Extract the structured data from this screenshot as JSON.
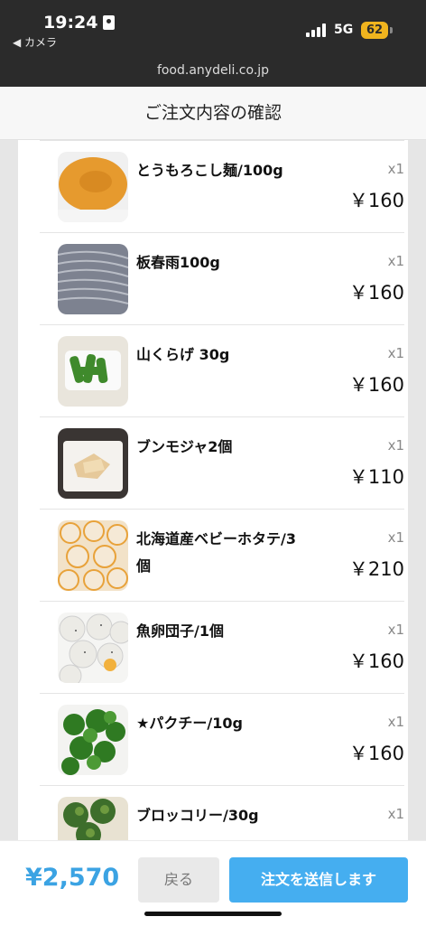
{
  "status_bar": {
    "time": "19:24",
    "back_app": "◀ カメラ",
    "network": "5G",
    "battery": "62",
    "url": "food.anydeli.co.jp"
  },
  "header": {
    "title": "ご注文内容の確認"
  },
  "items": [
    {
      "name": "とうもろこし麺/100g",
      "qty": "x1",
      "price": "￥160",
      "image": "corn-noodle-thumbnail"
    },
    {
      "name": "板春雨100g",
      "qty": "x1",
      "price": "￥160",
      "image": "glass-noodle-thumbnail"
    },
    {
      "name": "山くらげ 30g",
      "qty": "x1",
      "price": "￥160",
      "image": "celtuce-thumbnail"
    },
    {
      "name": "ブンモジャ2個",
      "qty": "x1",
      "price": "￥110",
      "image": "tofu-sheet-thumbnail"
    },
    {
      "name": "北海道産ベビーホタテ/3個",
      "qty": "x1",
      "price": "￥210",
      "image": "baby-scallop-thumbnail"
    },
    {
      "name": "魚卵団子/1個",
      "qty": "x1",
      "price": "￥160",
      "image": "fish-ball-thumbnail"
    },
    {
      "name": "★パクチー/10g",
      "qty": "x1",
      "price": "￥160",
      "image": "coriander-thumbnail"
    },
    {
      "name": "ブロッコリー/30g",
      "qty": "x1",
      "price": "",
      "image": "broccoli-thumbnail"
    }
  ],
  "footer": {
    "total": "¥2,570",
    "back_label": "戻る",
    "submit_label": "注文を送信します"
  },
  "colors": {
    "accent": "#45aef0",
    "total": "#3ba3e3",
    "status_bg": "#2b2b2b",
    "battery": "#f0b41e"
  }
}
